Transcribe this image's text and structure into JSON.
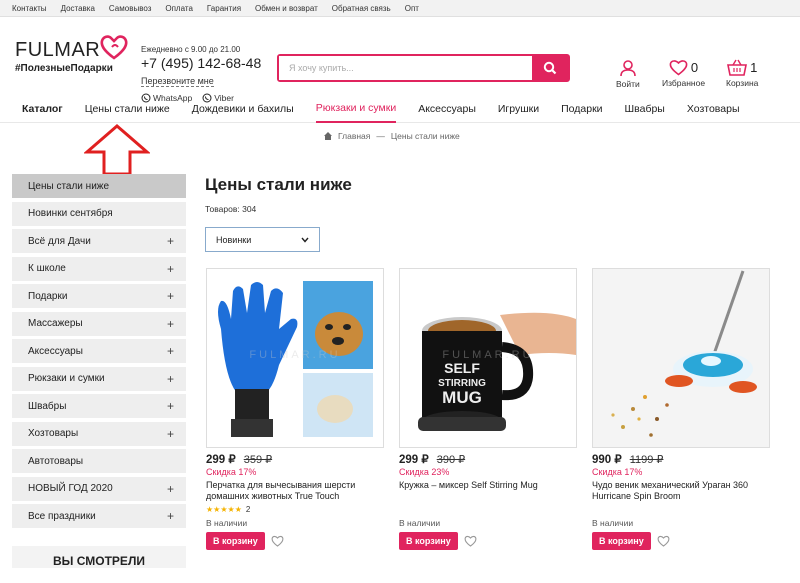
{
  "topbar": {
    "links": [
      "Контакты",
      "Доставка",
      "Самовывоз",
      "Оплата",
      "Гарантия",
      "Обмен и возврат",
      "Обратная связь",
      "Опт"
    ]
  },
  "header": {
    "logo": "FULMAR",
    "tagline": "#ПолезныеПодарки",
    "hours": "Ежедневно с 9.00 до 21.00",
    "phone": "+7 (495) 142-68-48",
    "callback": "Перезвоните мне",
    "whatsapp": "WhatsApp",
    "viber": "Viber",
    "search_placeholder": "Я хочу купить...",
    "login": "Войти",
    "favorites": "Избранное",
    "favorites_count": "0",
    "cart": "Корзина",
    "cart_count": "1"
  },
  "nav": {
    "items": [
      "Каталог",
      "Цены стали ниже",
      "Дождевики и бахилы",
      "Рюкзаки и сумки",
      "Аксессуары",
      "Игрушки",
      "Подарки",
      "Швабры",
      "Хозтовары"
    ]
  },
  "breadcrumb": {
    "home": "Главная",
    "sep": "—",
    "current": "Цены стали ниже"
  },
  "sidebar": {
    "items": [
      {
        "label": "Цены стали ниже",
        "plus": ""
      },
      {
        "label": "Новинки сентября",
        "plus": ""
      },
      {
        "label": "Всё для Дачи",
        "plus": "+"
      },
      {
        "label": "К школе",
        "plus": "+"
      },
      {
        "label": "Подарки",
        "plus": "+"
      },
      {
        "label": "Массажеры",
        "plus": "+"
      },
      {
        "label": "Аксессуары",
        "plus": "+"
      },
      {
        "label": "Рюкзаки и сумки",
        "plus": "+"
      },
      {
        "label": "Швабры",
        "plus": "+"
      },
      {
        "label": "Хозтовары",
        "plus": "+"
      },
      {
        "label": "Автотовары",
        "plus": ""
      },
      {
        "label": "НОВЫЙ ГОД 2020",
        "plus": "+"
      },
      {
        "label": "Все праздники",
        "plus": "+"
      }
    ],
    "seen": "ВЫ СМОТРЕЛИ"
  },
  "main": {
    "title": "Цены стали ниже",
    "count": "Товаров: 304",
    "sort": "Новинки"
  },
  "products": [
    {
      "price": "299 ₽",
      "old": "359 ₽",
      "discount": "Скидка 17%",
      "name": "Перчатка для вычесывания шерсти домашних животных True Touch",
      "reviews": "2",
      "stock": "В наличии",
      "buy": "В корзину"
    },
    {
      "price": "299 ₽",
      "old": "390 ₽",
      "discount": "Скидка 23%",
      "name": "Кружка – миксер Self Stirring Mug",
      "reviews": "",
      "stock": "В наличии",
      "buy": "В корзину"
    },
    {
      "price": "990 ₽",
      "old": "1199 ₽",
      "discount": "Скидка 17%",
      "name": "Чудо веник механический Ураган 360 Hurricane Spin Broom",
      "reviews": "",
      "stock": "В наличии",
      "buy": "В корзину"
    }
  ],
  "product_images": {
    "mug_text_1": "SELF",
    "mug_text_2": "STIRRING",
    "mug_text_3": "MUG",
    "watermark": "FULMAR.RU"
  },
  "colors": {
    "accent": "#e0245e",
    "arrow": "#e02020"
  }
}
